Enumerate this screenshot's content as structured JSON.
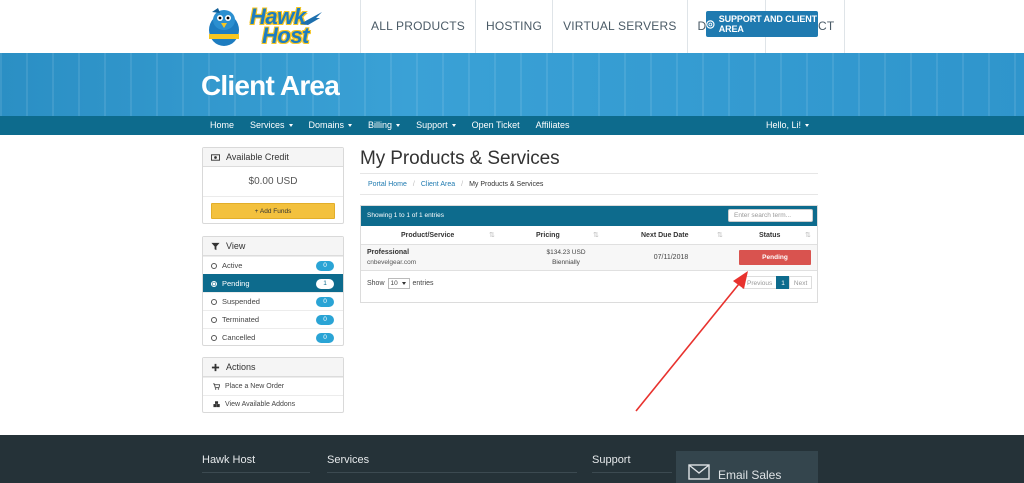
{
  "header": {
    "logo_line1": "Hawk",
    "logo_line2": "Host",
    "nav": [
      "ALL PRODUCTS",
      "HOSTING",
      "VIRTUAL SERVERS",
      "DOMAINS",
      "CONTACT"
    ],
    "support_button": "SUPPORT AND CLIENT AREA"
  },
  "hero": {
    "title": "Client Area"
  },
  "subnav": {
    "items": [
      {
        "label": "Home",
        "dropdown": false
      },
      {
        "label": "Services",
        "dropdown": true
      },
      {
        "label": "Domains",
        "dropdown": true
      },
      {
        "label": "Billing",
        "dropdown": true
      },
      {
        "label": "Support",
        "dropdown": true
      },
      {
        "label": "Open Ticket",
        "dropdown": false
      },
      {
        "label": "Affiliates",
        "dropdown": false
      }
    ],
    "greeting": "Hello, Li!"
  },
  "sidebar": {
    "credit": {
      "title": "Available Credit",
      "amount": "$0.00 USD",
      "button": "+ Add Funds"
    },
    "view": {
      "title": "View",
      "items": [
        {
          "label": "Active",
          "count": "0",
          "active": false
        },
        {
          "label": "Pending",
          "count": "1",
          "active": true
        },
        {
          "label": "Suspended",
          "count": "0",
          "active": false
        },
        {
          "label": "Terminated",
          "count": "0",
          "active": false
        },
        {
          "label": "Cancelled",
          "count": "0",
          "active": false
        }
      ]
    },
    "actions": {
      "title": "Actions",
      "items": [
        "Place a New Order",
        "View Available Addons"
      ]
    }
  },
  "main": {
    "title": "My Products & Services",
    "breadcrumb": [
      "Portal Home",
      "Client Area",
      "My Products & Services"
    ],
    "table": {
      "showing": "Showing 1 to 1 of 1 entries",
      "search_placeholder": "Enter search term...",
      "columns": [
        "Product/Service",
        "Pricing",
        "Next Due Date",
        "Status"
      ],
      "row": {
        "product": "Professional",
        "domain": "cnbevelgear.com",
        "price": "$134.23 USD",
        "cycle": "Biennially",
        "due": "07/11/2018",
        "status": "Pending"
      },
      "show_label": "Show",
      "length": "10",
      "entries_label": "entries",
      "pager": {
        "previous": "Previous",
        "page": "1",
        "next": "Next"
      }
    }
  },
  "footer": {
    "columns": [
      "Hawk Host",
      "Services",
      "Support"
    ],
    "email_sales": "Email Sales"
  },
  "colors": {
    "brand_blue": "#1f7ab0",
    "nav_teal": "#0d6b8d",
    "status_red": "#d9534f",
    "funds_yellow": "#f3c13e",
    "arrow_red": "#e8322e"
  }
}
